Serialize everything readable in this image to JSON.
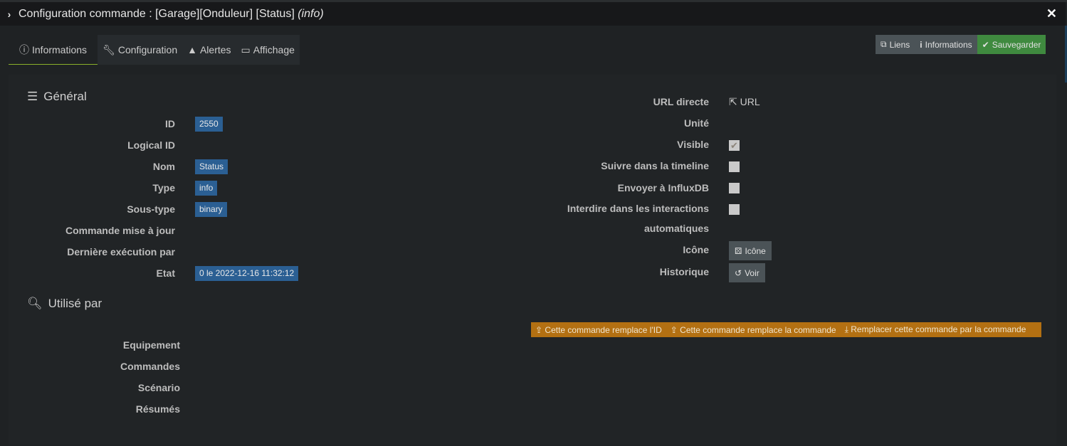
{
  "title": {
    "main": "Configuration commande : [Garage][Onduleur] [Status]",
    "type": "(info)"
  },
  "tabs": [
    {
      "label": "Informations",
      "icon": "info-circle-icon"
    },
    {
      "label": "Configuration",
      "icon": "wrench-icon"
    },
    {
      "label": "Alertes",
      "icon": "warning-icon"
    },
    {
      "label": "Affichage",
      "icon": "monitor-icon"
    }
  ],
  "actions": {
    "links": "Liens",
    "informations": "Informations",
    "save": "Sauvegarder"
  },
  "general": {
    "title": "Général",
    "fields": [
      {
        "label": "ID",
        "value": "2550"
      },
      {
        "label": "Logical ID",
        "value": ""
      },
      {
        "label": "Nom",
        "value": "Status"
      },
      {
        "label": "Type",
        "value": "info"
      },
      {
        "label": "Sous-type",
        "value": "binary"
      },
      {
        "label": "Commande mise à jour",
        "value": ""
      },
      {
        "label": "Dernière exécution par",
        "value": ""
      },
      {
        "label": "Etat",
        "value": "0 le 2022-12-16 11:32:12"
      }
    ]
  },
  "right": {
    "url_label": "URL directe",
    "url_link": "URL",
    "unit_label": "Unité",
    "visible_label": "Visible",
    "visible": true,
    "timeline_label": "Suivre dans la timeline",
    "timeline": false,
    "influx_label": "Envoyer à InfluxDB",
    "influx": false,
    "interact_label_1": "Interdire dans les interactions",
    "interact_label_2": "automatiques",
    "interact": false,
    "icon_label": "Icône",
    "icon_button": "Icône",
    "history_label": "Historique",
    "history_button": "Voir"
  },
  "used_by": {
    "title": "Utilisé par",
    "rows": [
      "Equipement",
      "Commandes",
      "Scénario",
      "Résumés"
    ]
  },
  "replace": {
    "replace_id": "Cette commande remplace l'ID",
    "replace_cmd": "Cette commande remplace la commande",
    "replace_by": "Remplacer cette commande par la commande"
  },
  "colors": {
    "save": "#3f8a3f",
    "badge": "#2b5f93",
    "orange": "#b37012",
    "tab_underline": "#8ab02a"
  }
}
